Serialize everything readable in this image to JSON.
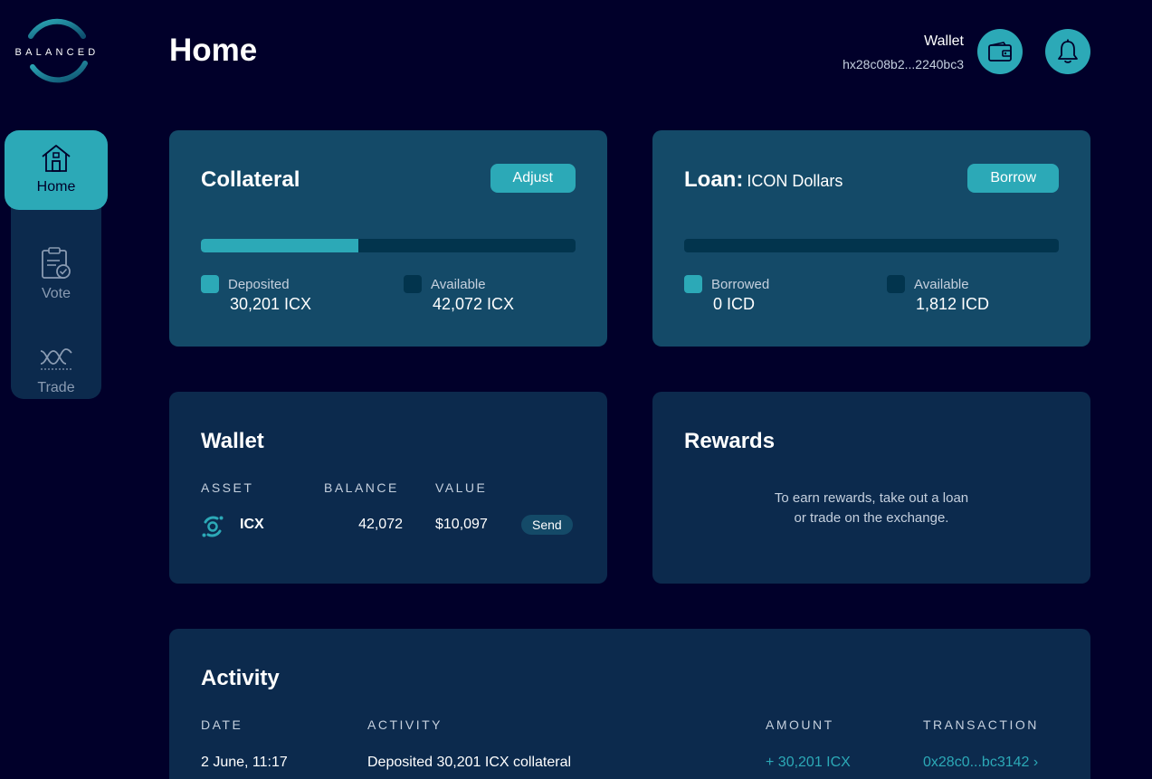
{
  "logo": {
    "text": "BALANCED"
  },
  "nav": {
    "home": "Home",
    "vote": "Vote",
    "trade": "Trade"
  },
  "header": {
    "title": "Home",
    "wallet_label": "Wallet",
    "wallet_address": "hx28c08b2...2240bc3"
  },
  "collateral": {
    "title": "Collateral",
    "button": "Adjust",
    "fill_fraction": 0.42,
    "deposited_label": "Deposited",
    "deposited_value": "30,201 ICX",
    "available_label": "Available",
    "available_value": "42,072 ICX"
  },
  "loan": {
    "title": "Loan:",
    "subtitle": "ICON Dollars",
    "button": "Borrow",
    "fill_fraction": 0,
    "borrowed_label": "Borrowed",
    "borrowed_value": "0 ICD",
    "available_label": "Available",
    "available_value": "1,812 ICD"
  },
  "wallet": {
    "title": "Wallet",
    "columns": [
      "ASSET",
      "BALANCE",
      "VALUE"
    ],
    "rows": [
      {
        "asset": "ICX",
        "balance": "42,072",
        "value": "$10,097",
        "action": "Send"
      }
    ]
  },
  "rewards": {
    "title": "Rewards",
    "line1": "To earn rewards, take out a loan",
    "line2": "or trade on the exchange."
  },
  "activity": {
    "title": "Activity",
    "columns": [
      "DATE",
      "ACTIVITY",
      "AMOUNT",
      "TRANSACTION"
    ],
    "rows": [
      {
        "date": "2 June, 11:17",
        "activity": "Deposited 30,201 ICX collateral",
        "amount": "+ 30,201 ICX",
        "transaction": "0x28c0...bc3142 ›"
      }
    ]
  },
  "colors": {
    "background": "#01002a",
    "accent": "#2ca9b7",
    "card_dark": "#0c2a4d",
    "card_light": "#144a68"
  }
}
